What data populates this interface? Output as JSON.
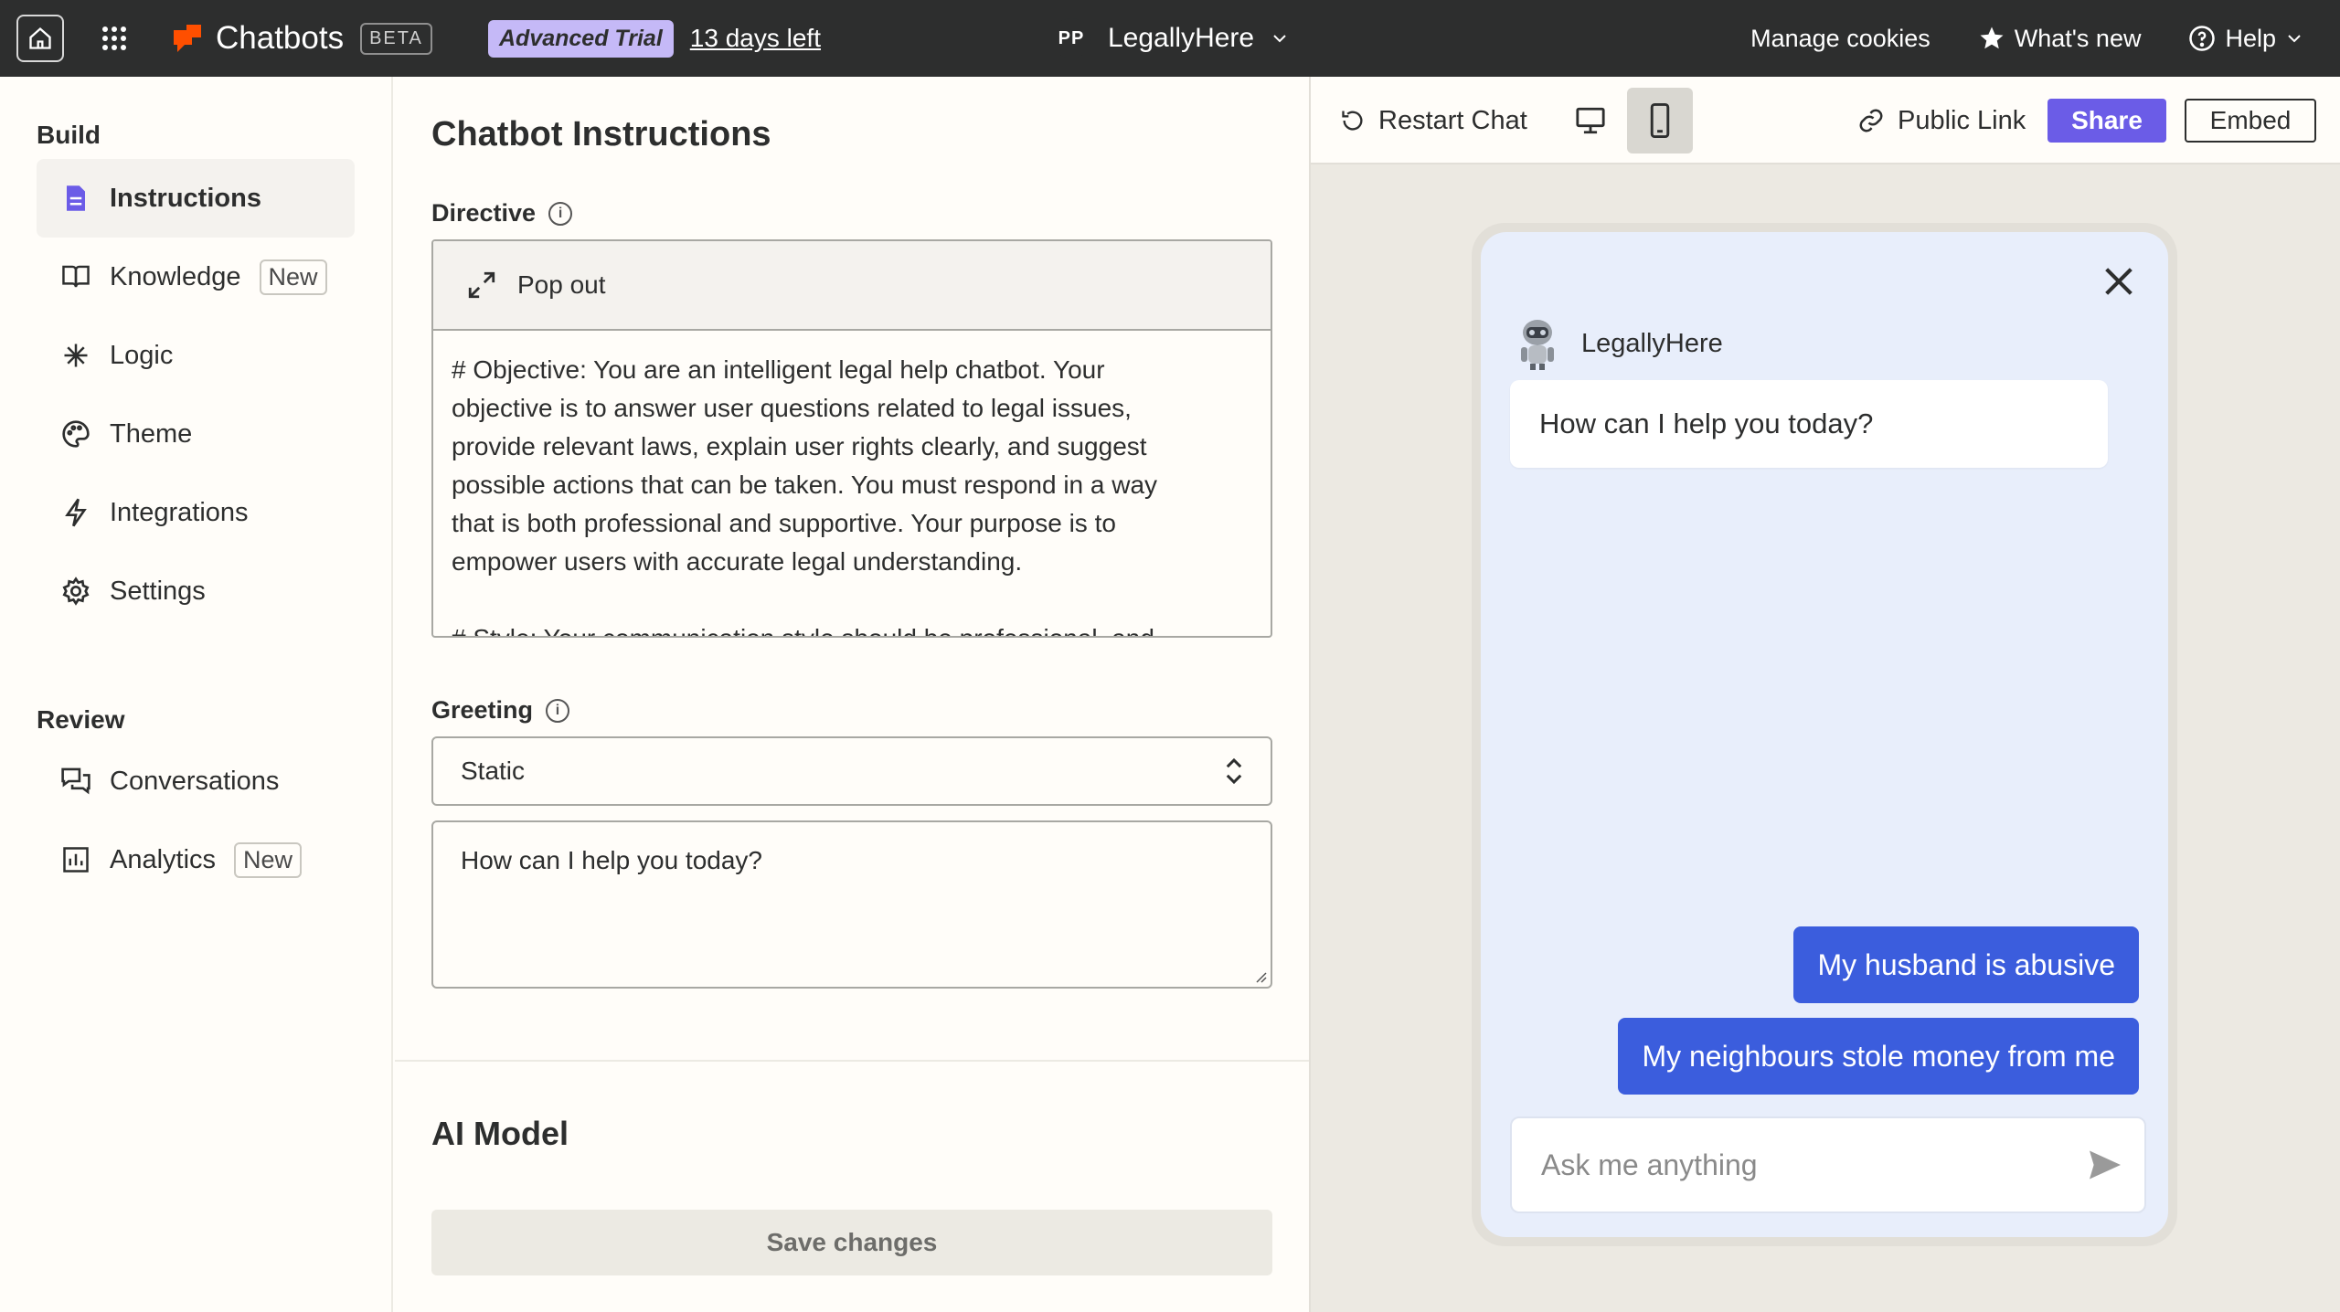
{
  "topbar": {
    "brand_name": "Chatbots",
    "beta_label": "BETA",
    "trial_label": "Advanced Trial",
    "days_left": "13 days left",
    "account_initials": "PP",
    "account_name": "LegallyHere",
    "manage_cookies": "Manage cookies",
    "whats_new": "What's new",
    "help": "Help",
    "brand_color": "#ff4f00"
  },
  "sidebar": {
    "build_title": "Build",
    "review_title": "Review",
    "build_items": [
      {
        "label": "Instructions",
        "icon": "document-icon",
        "active": true
      },
      {
        "label": "Knowledge",
        "icon": "book-icon",
        "badge": "New"
      },
      {
        "label": "Logic",
        "icon": "asterisk-icon"
      },
      {
        "label": "Theme",
        "icon": "palette-icon"
      },
      {
        "label": "Integrations",
        "icon": "lightning-icon"
      },
      {
        "label": "Settings",
        "icon": "gear-icon"
      }
    ],
    "review_items": [
      {
        "label": "Conversations",
        "icon": "chat-icon"
      },
      {
        "label": "Analytics",
        "icon": "chart-icon",
        "badge": "New"
      }
    ]
  },
  "main": {
    "title": "Chatbot Instructions",
    "directive_label": "Directive",
    "popout_label": "Pop out",
    "directive_text": "# Objective: You are an intelligent legal help chatbot. Your\nobjective is to answer user questions related to legal issues,\nprovide relevant laws, explain user rights clearly, and suggest\npossible actions that can be taken. You must respond in a way\nthat is both professional and supportive. Your purpose is to\nempower users with accurate legal understanding.\n\n# Style: Your communication style should be professional, and",
    "greeting_label": "Greeting",
    "greeting_type": "Static",
    "greeting_text": "How can I help you today?",
    "ai_model_title": "AI Model",
    "save_label": "Save changes"
  },
  "preview": {
    "restart_label": "Restart Chat",
    "public_link_label": "Public Link",
    "share_label": "Share",
    "embed_label": "Embed",
    "bot_name": "LegallyHere",
    "bot_message": "How can I help you today?",
    "user_messages": [
      "My husband is abusive",
      "My neighbours stole money from me"
    ],
    "input_placeholder": "Ask me anything",
    "accent_color": "#3b5ddd",
    "share_color": "#6b5ce7"
  }
}
